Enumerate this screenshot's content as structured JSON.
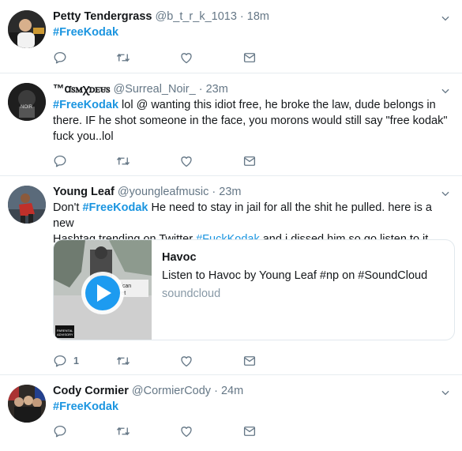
{
  "tweets": [
    {
      "name": "Petty Tendergrass",
      "handle": "@b_t_r_k_1013",
      "time": "18m",
      "tag": "#FreeKodak"
    },
    {
      "name": "™ꭤꮪꮇꭓꭰꭼꮜꮪ",
      "handle": "@Surreal_Noir_",
      "time": "23m",
      "tag": "#FreeKodak",
      "text1": " lol @ wanting this idiot free, he broke the law, dude belongs in",
      "line2": "there. IF he shot someone in the face, you morons would still say \"free kodak\"",
      "line3": "fuck you..lol"
    },
    {
      "name": "Young Leaf",
      "handle": "@youngleafmusic",
      "time": "23m",
      "pre": "Don't ",
      "tag": "#FreeKodak",
      "mid": " He need to stay in jail for all the shit he pulled. here is a new",
      "line2pre": "Hashtag trending on Twitter ",
      "tag2": "#FuckKodak",
      "line2post": " and i dissed him so go listen to it",
      "card": {
        "title": "Havoc",
        "description": "Listen to Havoc by Young Leaf #np on #SoundCloud",
        "domain": "soundcloud"
      },
      "reply_count": "1"
    },
    {
      "name": "Cody Cormier",
      "handle": "@CormierCody",
      "time": "24m",
      "tag": "#FreeKodak"
    }
  ],
  "sep": "·",
  "icons": [
    "reply-icon",
    "retweet-icon",
    "like-icon",
    "dm-icon",
    "chevron-down-icon"
  ],
  "colors": {
    "link": "#1b95e0",
    "muted": "#657786",
    "border": "#e6ecf0"
  }
}
